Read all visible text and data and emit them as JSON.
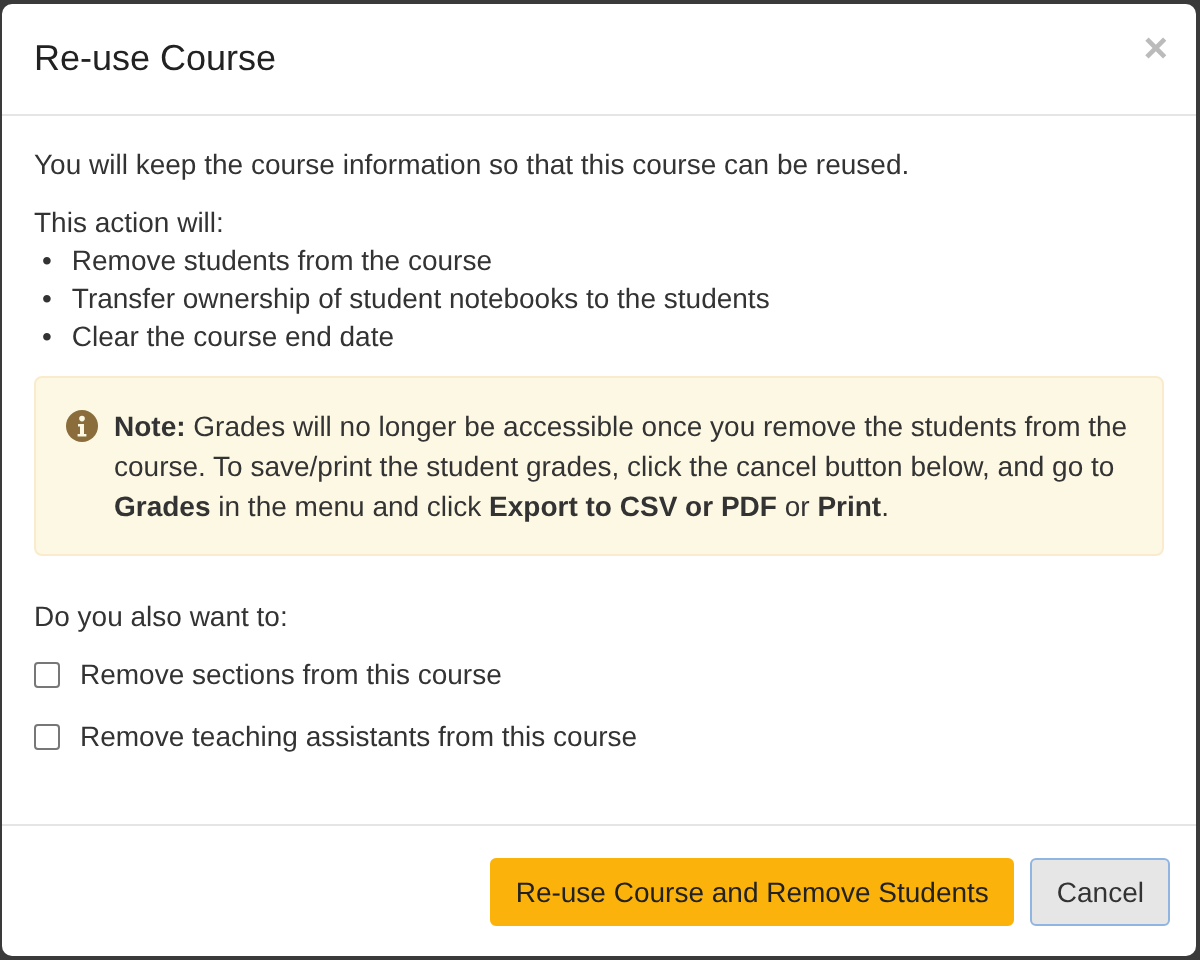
{
  "dialog": {
    "title": "Re-use Course",
    "close": "×"
  },
  "intro": "You will keep the course information so that this course can be reused.",
  "actions_heading": "This action will:",
  "actions": [
    {
      "marker": "•",
      "text": "Remove students from the course"
    },
    {
      "marker": "•",
      "text": "Transfer ownership of student notebooks to the students"
    },
    {
      "marker": "•",
      "text": "Clear the course end date"
    }
  ],
  "note": "**Note:** Grades will no longer be accessible once you remove the students from the course. To save/print the student grades, click the cancel button below, and go to **Grades** in the menu and click **Export to CSV or PDF** or **Print**.",
  "options_heading": "Do you also want to:",
  "options": [
    {
      "label": "Remove sections from this course",
      "checked": false
    },
    {
      "label": "Remove teaching assistants from this course",
      "checked": false
    }
  ],
  "buttons": [
    {
      "label": "Re-use Course and Remove Students",
      "kind": "primary"
    },
    {
      "label": "Cancel",
      "kind": "default"
    }
  ]
}
